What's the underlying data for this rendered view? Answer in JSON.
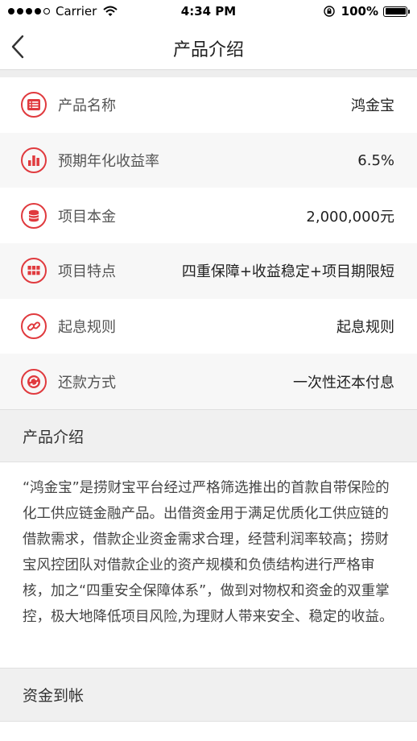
{
  "status_bar": {
    "carrier": "Carrier",
    "time": "4:34 PM",
    "battery": "100%"
  },
  "nav": {
    "title": "产品介绍"
  },
  "accent_color": "#e03a3e",
  "rows": [
    {
      "icon": "list-icon",
      "label": "产品名称",
      "value": "鸿金宝"
    },
    {
      "icon": "bar-chart-icon",
      "label": "预期年化收益率",
      "value": "6.5%"
    },
    {
      "icon": "coins-icon",
      "label": "项目本金",
      "value": "2,000,000元"
    },
    {
      "icon": "grid-icon",
      "label": "项目特点",
      "value": "四重保障+收益稳定+项目期限短"
    },
    {
      "icon": "link-icon",
      "label": "起息规则",
      "value": "起息规则"
    },
    {
      "icon": "refresh-icon",
      "label": "还款方式",
      "value": "一次性还本付息"
    }
  ],
  "intro": {
    "heading": "产品介绍",
    "text": "“鸿金宝”是捞财宝平台经过严格筛选推出的首款自带保险的化工供应链金融产品。出借资金用于满足优质化工供应链的借款需求，借款企业资金需求合理，经营利润率较高；捞财宝风控团队对借款企业的资产规模和负债结构进行严格审核，加之“四重安全保障体系”，做到对物权和资金的双重掌控，极大地降低项目风险,为理财人带来安全、稳定的收益。"
  },
  "funds": {
    "heading": "资金到帐"
  }
}
